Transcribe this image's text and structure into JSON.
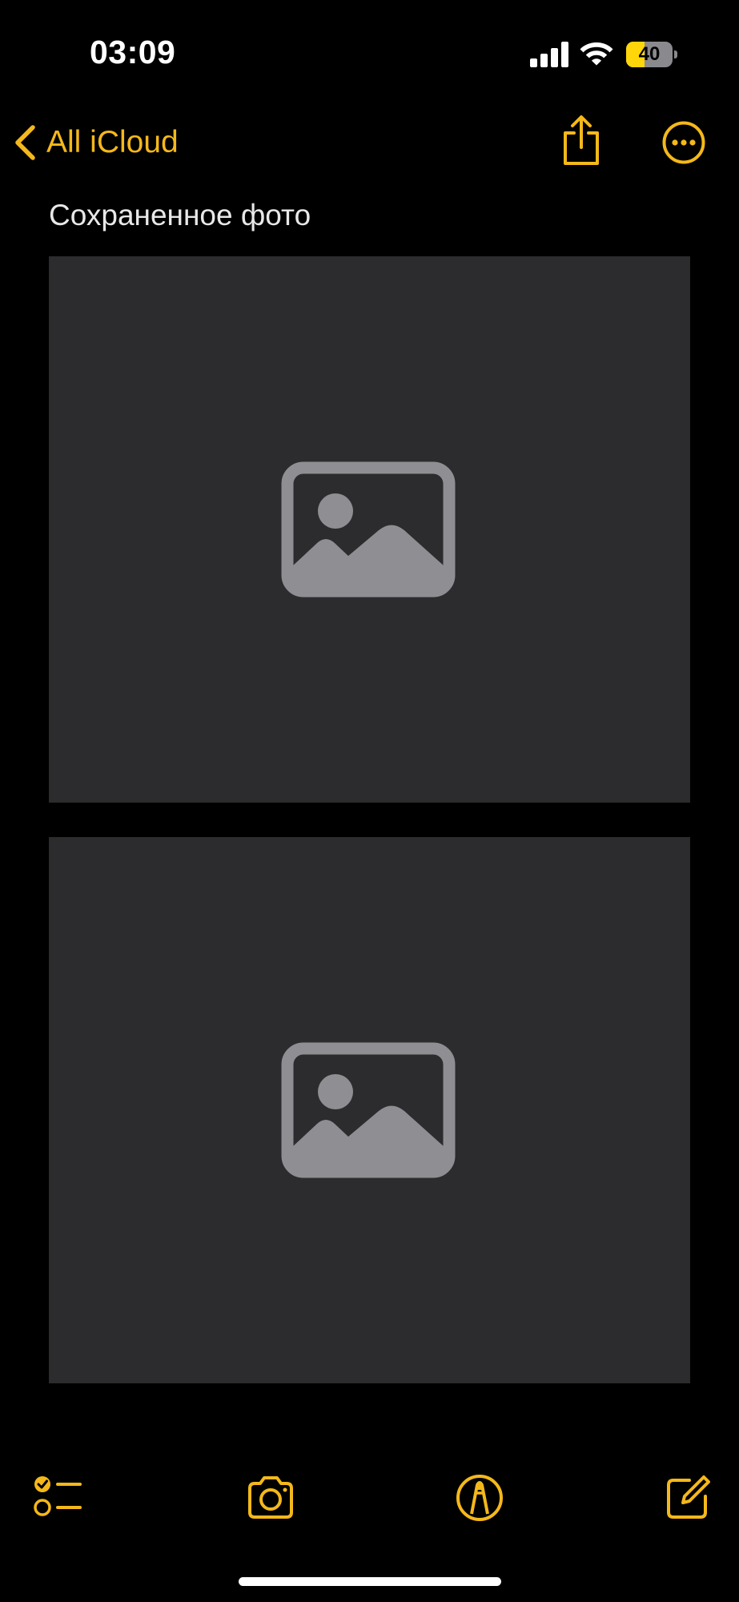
{
  "status_bar": {
    "time": "03:09",
    "battery_level": "40",
    "battery_fraction": 0.4,
    "signal_bars": 4,
    "icons": [
      "cellular-signal-icon",
      "wifi-icon",
      "battery-icon"
    ]
  },
  "nav": {
    "back_label": "All iCloud",
    "icons": [
      "chevron-left-icon",
      "share-icon",
      "more-icon"
    ]
  },
  "note": {
    "title": "Сохраненное фото",
    "photos": [
      {
        "state": "placeholder",
        "icon": "photo-placeholder-icon"
      },
      {
        "state": "placeholder",
        "icon": "photo-placeholder-icon"
      }
    ]
  },
  "toolbar": {
    "icons": [
      "checklist-icon",
      "camera-icon",
      "markup-icon",
      "compose-icon"
    ]
  },
  "colors": {
    "accent": "#f4b81a",
    "background": "#000000",
    "photo_placeholder": "#2c2c2e",
    "placeholder_icon": "#8e8e93",
    "title_text": "#e8e8ea",
    "battery_fill": "#ffd60a"
  }
}
